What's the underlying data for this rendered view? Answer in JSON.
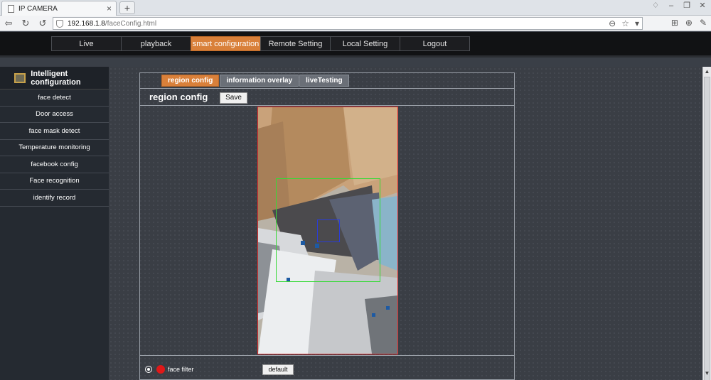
{
  "browser": {
    "tab_title": "IP CAMERA",
    "tab_close": "×",
    "new_tab": "+",
    "url_host": "192.168.1.8",
    "url_path": "/faceConfig.html"
  },
  "menu": {
    "items": [
      {
        "label": "Live"
      },
      {
        "label": "playback"
      },
      {
        "label": "smart configuration"
      },
      {
        "label": "Remote Setting"
      },
      {
        "label": "Local Setting"
      },
      {
        "label": "Logout"
      }
    ],
    "active_index": 2
  },
  "sidebar": {
    "header": "Intelligent configuration",
    "items": [
      {
        "label": "face detect"
      },
      {
        "label": "Door access"
      },
      {
        "label": "face mask detect"
      },
      {
        "label": "Temperature monitoring"
      },
      {
        "label": "facebook config"
      },
      {
        "label": "Face recognition"
      },
      {
        "label": "identify record"
      }
    ]
  },
  "main": {
    "tabs": [
      {
        "label": "region config"
      },
      {
        "label": "information overlay"
      },
      {
        "label": "liveTesting"
      }
    ],
    "title": "region config",
    "save_label": "Save",
    "filter_label": "face filter",
    "default_label": "default"
  },
  "colors": {
    "accent": "#d9803a",
    "roi_box": "#37d937",
    "face_box": "#2a3cd8",
    "video_border": "#e03030",
    "filter_dot": "#e01818"
  }
}
